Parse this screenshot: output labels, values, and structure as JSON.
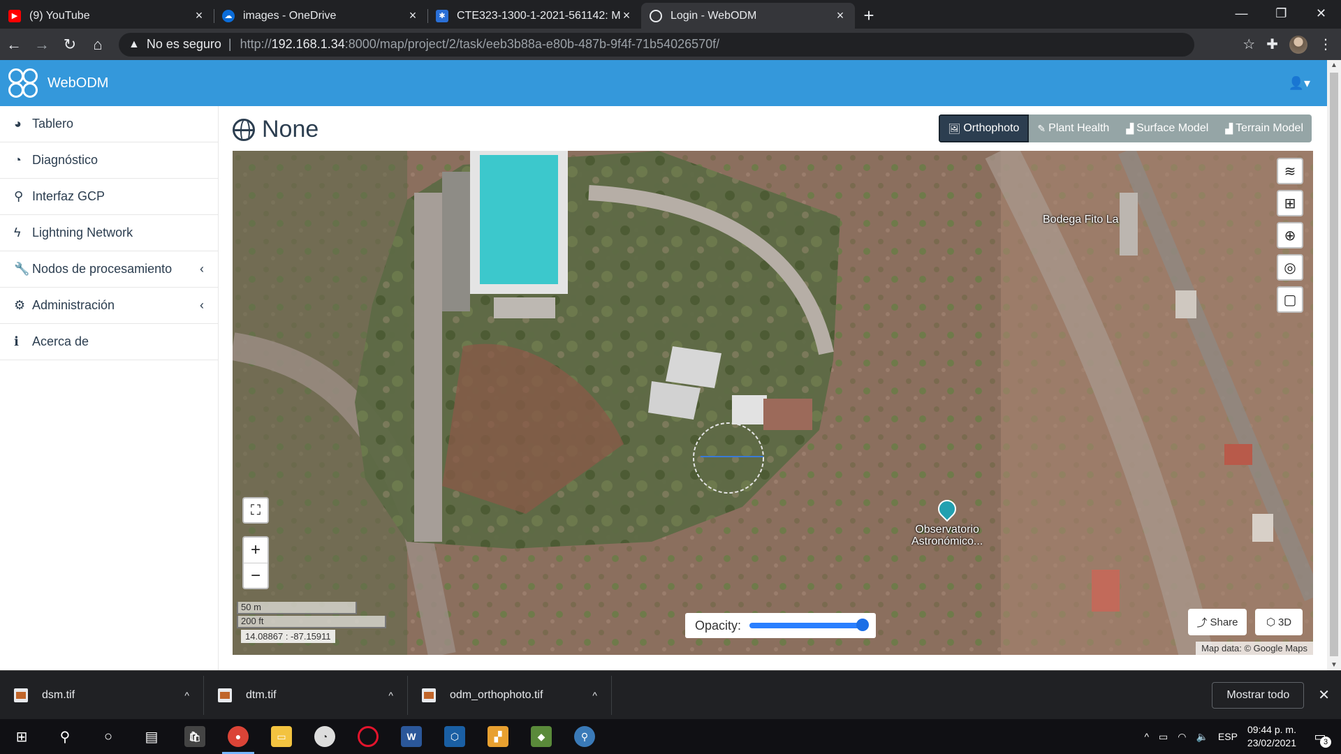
{
  "browser": {
    "tabs": [
      {
        "title": "(9) YouTube",
        "favicon": "youtube-icon",
        "color": "#ff0000",
        "active": false
      },
      {
        "title": "images - OneDrive",
        "favicon": "onedrive-icon",
        "color": "#0a6cd9",
        "active": false
      },
      {
        "title": "CTE323-1300-1-2021-561142: M...",
        "favicon": "moodle-icon",
        "color": "#2a6fd6",
        "active": false
      },
      {
        "title": "Login - WebODM",
        "favicon": "webodm-icon",
        "color": "#35363a",
        "active": true
      }
    ],
    "security_label": "No es seguro",
    "url_prefix": "http://",
    "url_host": "192.168.1.34",
    "url_rest": ":8000/map/project/2/task/eeb3b88a-e80b-487b-9f4f-71b54026570f/"
  },
  "app": {
    "brand": "WebODM",
    "primary_color": "#3498db"
  },
  "sidebar": {
    "items": [
      {
        "label": "Tablero",
        "icon": "dashboard-icon"
      },
      {
        "label": "Diagnóstico",
        "icon": "pie-chart-icon"
      },
      {
        "label": "Interfaz GCP",
        "icon": "map-marker-icon"
      },
      {
        "label": "Lightning Network",
        "icon": "bolt-icon"
      },
      {
        "label": "Nodos de procesamiento",
        "icon": "wrench-icon",
        "expandable": true
      },
      {
        "label": "Administración",
        "icon": "cogs-icon",
        "expandable": true
      },
      {
        "label": "Acerca de",
        "icon": "info-icon"
      }
    ]
  },
  "main": {
    "title": "None",
    "view_buttons": [
      {
        "label": "Orthophoto",
        "icon": "image-icon",
        "active": true
      },
      {
        "label": "Plant Health",
        "icon": "leaf-icon",
        "active": false
      },
      {
        "label": "Surface Model",
        "icon": "chart-area-icon",
        "active": false
      },
      {
        "label": "Terrain Model",
        "icon": "chart-area-icon",
        "active": false
      }
    ]
  },
  "map": {
    "scale_metric": "50 m",
    "scale_imperial": "200 ft",
    "coordinates": "14.08867 : -87.15911",
    "opacity_label": "Opacity:",
    "opacity_value": 1.0,
    "share_label": "Share",
    "three_d_label": "3D",
    "attribution": "Map data: © Google Maps",
    "labels": {
      "bodega": "Bodega Fito La",
      "observatorio_1": "Observatorio",
      "observatorio_2": "Astronómico..."
    }
  },
  "downloads": {
    "files": [
      "dsm.tif",
      "dtm.tif",
      "odm_orthophoto.tif"
    ],
    "show_all": "Mostrar todo"
  },
  "taskbar": {
    "language": "ESP",
    "time": "09:44 p. m.",
    "date": "23/02/2021",
    "notification_count": "3"
  }
}
